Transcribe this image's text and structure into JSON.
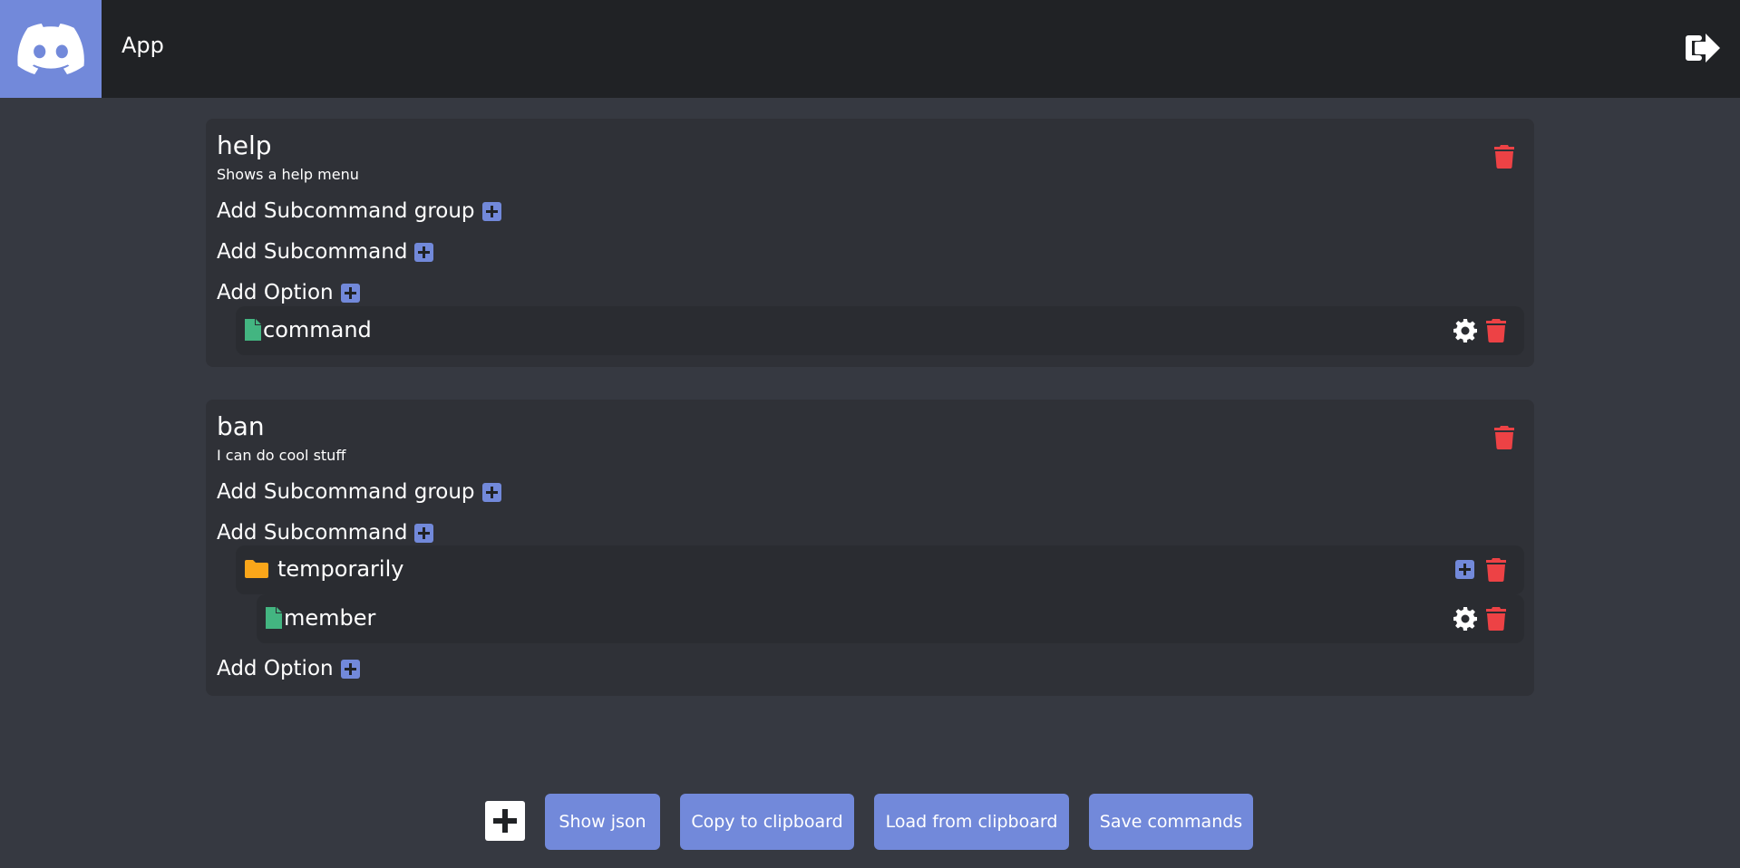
{
  "header": {
    "app_title": "App",
    "logo_icon": "discord-logo-icon",
    "logout_icon": "sign-out-icon"
  },
  "commands": [
    {
      "name": "help",
      "description": "Shows a help menu",
      "add_subcommand_group_label": "Add Subcommand group",
      "add_subcommand_label": "Add Subcommand",
      "add_option_label": "Add Option",
      "options": [
        {
          "name": "command",
          "icon": "file-icon"
        }
      ]
    },
    {
      "name": "ban",
      "description": "I can do cool stuff",
      "add_subcommand_group_label": "Add Subcommand group",
      "add_subcommand_label": "Add Subcommand",
      "add_option_label": "Add Option",
      "subcommand_groups": [
        {
          "name": "temporarily",
          "icon": "folder-icon",
          "subcommands": [
            {
              "name": "member",
              "icon": "file-icon"
            }
          ]
        }
      ]
    }
  ],
  "footer": {
    "show_json_label": "Show json",
    "copy_label": "Copy to clipboard",
    "load_label": "Load from clipboard",
    "save_label": "Save commands"
  },
  "colors": {
    "accent": "#7289da",
    "danger": "#ed4245",
    "file": "#43b581",
    "folder": "#faa61a",
    "background": "#363941",
    "card": "#2f3137",
    "topbar": "#202225"
  }
}
